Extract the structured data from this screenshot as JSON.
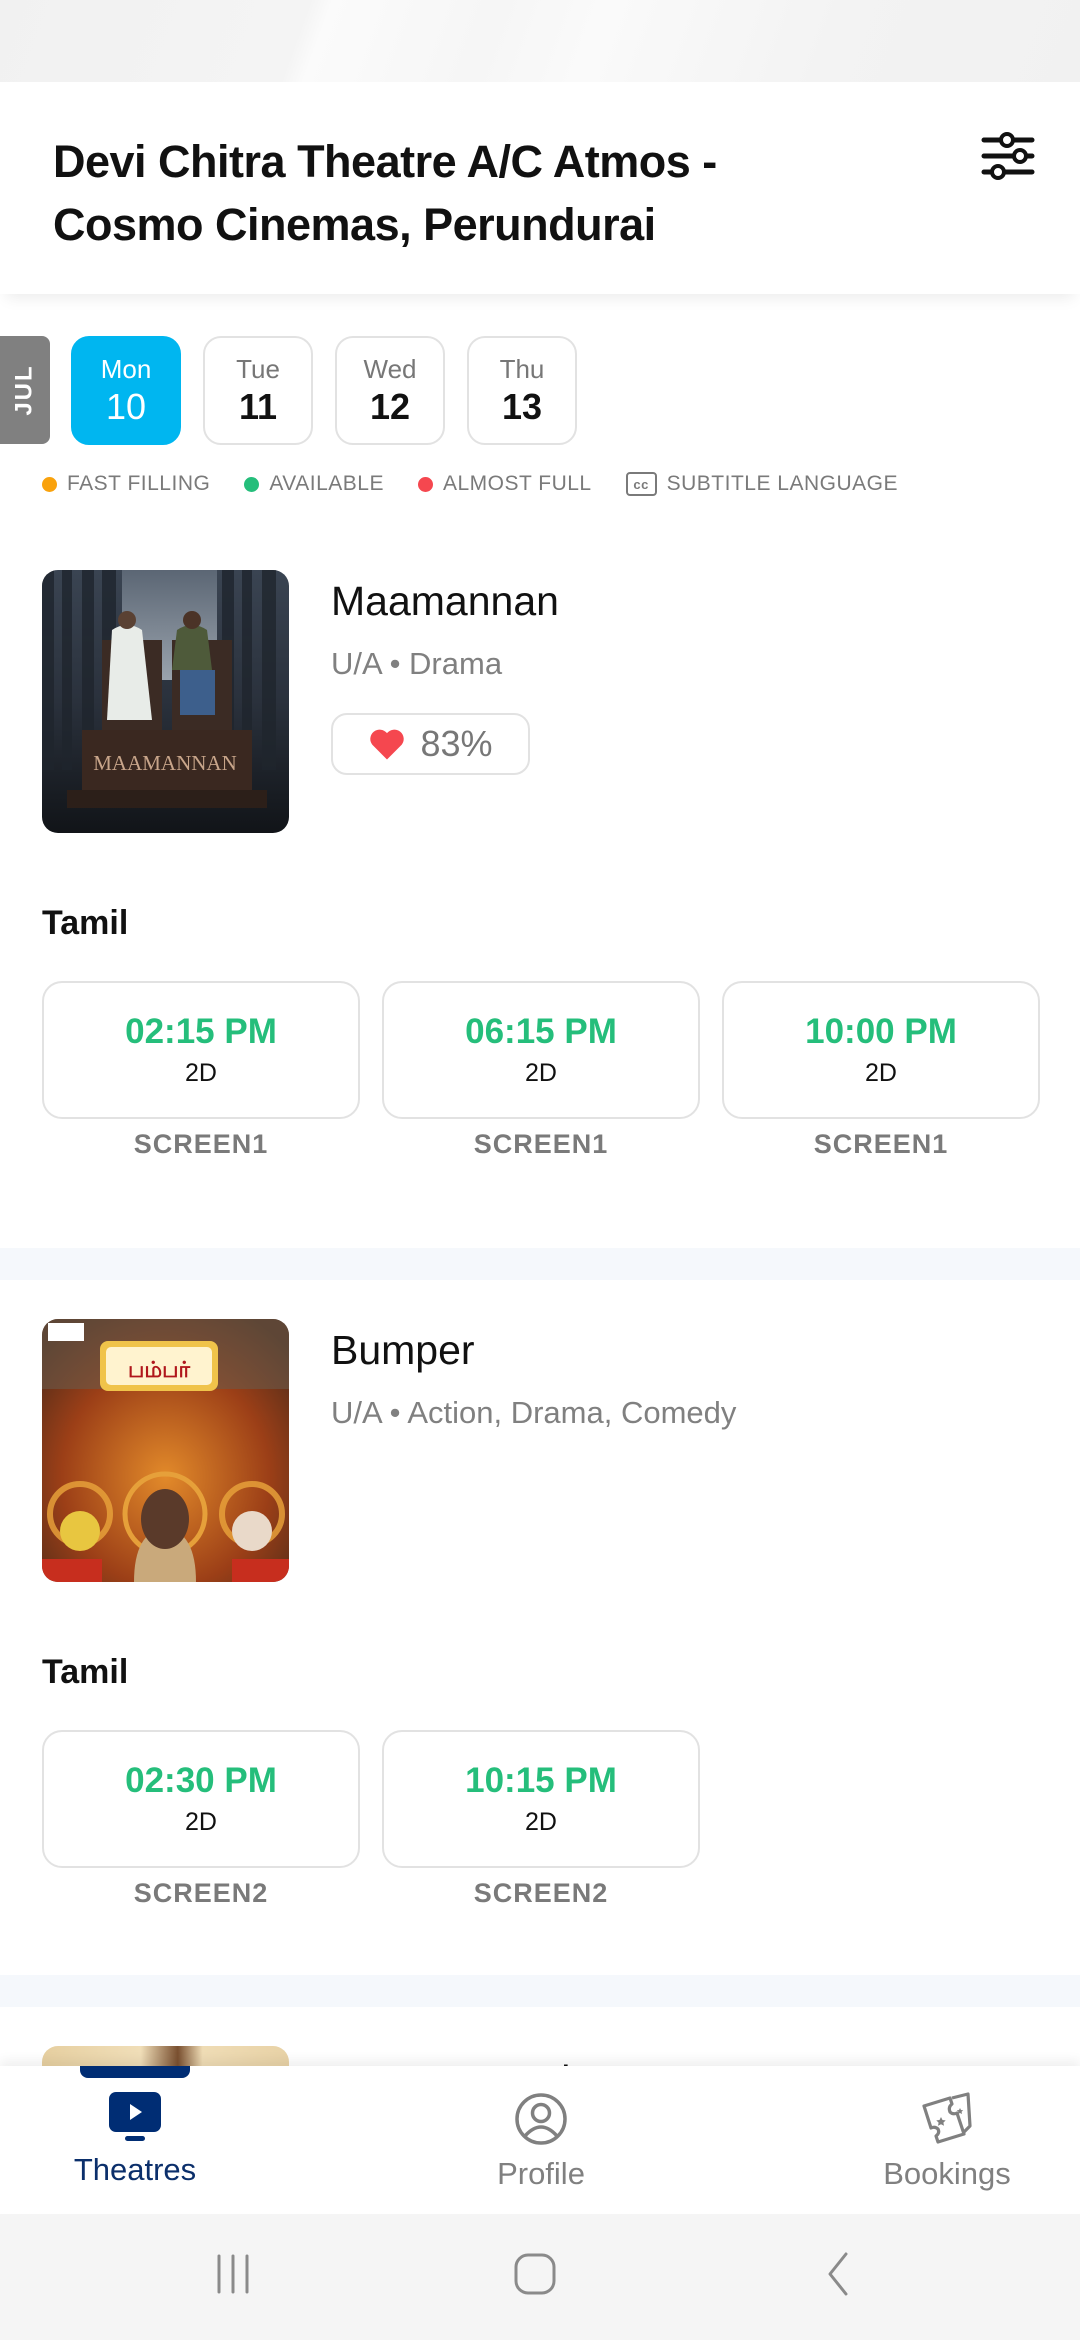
{
  "header": {
    "title": "Devi Chitra Theatre A/C Atmos - Cosmo Cinemas, Perundurai",
    "filter_icon": "sliders-icon"
  },
  "dates": {
    "month": "JUL",
    "items": [
      {
        "dow": "Mon",
        "day": "10",
        "selected": true
      },
      {
        "dow": "Tue",
        "day": "11",
        "selected": false
      },
      {
        "dow": "Wed",
        "day": "12",
        "selected": false
      },
      {
        "dow": "Thu",
        "day": "13",
        "selected": false
      }
    ]
  },
  "legend": [
    {
      "label": "FAST FILLING",
      "color": "#f9a20d"
    },
    {
      "label": "AVAILABLE",
      "color": "#25be7b"
    },
    {
      "label": "ALMOST FULL",
      "color": "#f5474f"
    },
    {
      "label": "SUBTITLE LANGUAGE",
      "icon": "cc",
      "icon_name": "subtitle-cc-icon"
    }
  ],
  "movies": [
    {
      "title": "Maamannan",
      "meta": "U/A • Drama",
      "rating": "83%",
      "rating_icon": "heart-icon",
      "poster_text": "MAAMANNAN",
      "language": "Tamil",
      "shows": [
        {
          "time": "02:15 PM",
          "format": "2D",
          "screen": "SCREEN1"
        },
        {
          "time": "06:15 PM",
          "format": "2D",
          "screen": "SCREEN1"
        },
        {
          "time": "10:00 PM",
          "format": "2D",
          "screen": "SCREEN1"
        }
      ]
    },
    {
      "title": "Bumper",
      "meta": "U/A • Action, Drama, Comedy",
      "poster_text": "பம்பர்",
      "language": "Tamil",
      "shows": [
        {
          "time": "02:30 PM",
          "format": "2D",
          "screen": "SCREEN2"
        },
        {
          "time": "10:15 PM",
          "format": "2D",
          "screen": "SCREEN2"
        }
      ]
    },
    {
      "title": "Porur Pongal...",
      "partial": true
    }
  ],
  "bottom_nav": {
    "items": [
      {
        "label": "Theatres",
        "icon": "theatre-play-icon",
        "active": true
      },
      {
        "label": "Profile",
        "icon": "profile-icon",
        "active": false
      },
      {
        "label": "Bookings",
        "icon": "tickets-icon",
        "active": false
      }
    ]
  },
  "colors": {
    "accent": "#00b6f0",
    "available": "#25be7b",
    "fast_filling": "#f9a20d",
    "almost_full": "#f5474f",
    "nav_active": "#0b2f6b"
  }
}
